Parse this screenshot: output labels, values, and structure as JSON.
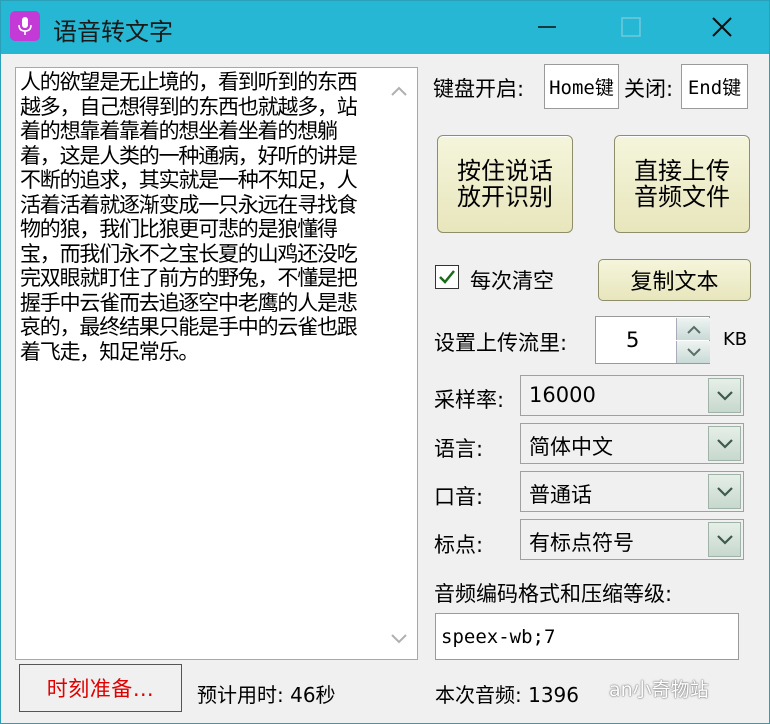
{
  "window": {
    "title": "语音转文字",
    "icon": "microphone-icon",
    "accent": "#25b7d3"
  },
  "text_area": {
    "content": "人的欲望是无止境的，看到听到的东西越多，自己想得到的东西也就越多，站着的想靠着靠着的想坐着坐着的想躺着，这是人类的一种通病，好听的讲是不断的追求，其实就是一种不知足，人活着活着就逐渐变成一只永远在寻找食物的狼，我们比狼更可悲的是狼懂得宝，而我们永不之宝长夏的山鸡还没吃完双眼就盯住了前方的野兔，不懂是把握手中云雀而去追逐空中老鹰的人是悲哀的，最终结果只能是手中的云雀也跟着飞走，知足常乐。"
  },
  "keys": {
    "open_label": "键盘开启:",
    "open_value": "Home键",
    "close_label": "关闭:",
    "close_value": "End键"
  },
  "buttons": {
    "hold_line1": "按住说话",
    "hold_line2": "放开识别",
    "upload_line1": "直接上传",
    "upload_line2": "音频文件",
    "copy": "复制文本"
  },
  "clear_each": {
    "label": "每次清空",
    "checked": true
  },
  "upload_rate": {
    "label": "设置上传流里:",
    "value": "5",
    "unit": "KB"
  },
  "sample_rate": {
    "label": "采样率:",
    "value": "16000"
  },
  "language": {
    "label": "语言:",
    "value": "简体中文"
  },
  "accent": {
    "label": "口音:",
    "value": "普通话"
  },
  "punctuation": {
    "label": "标点:",
    "value": "有标点符号"
  },
  "codec": {
    "label": "音频编码格式和压缩等级:",
    "value": "speex-wb;7"
  },
  "status": {
    "ready": "时刻准备…",
    "estimated": "预计用时: 46秒",
    "audio": "本次音频: 1396"
  },
  "watermark": "an小奇物站"
}
